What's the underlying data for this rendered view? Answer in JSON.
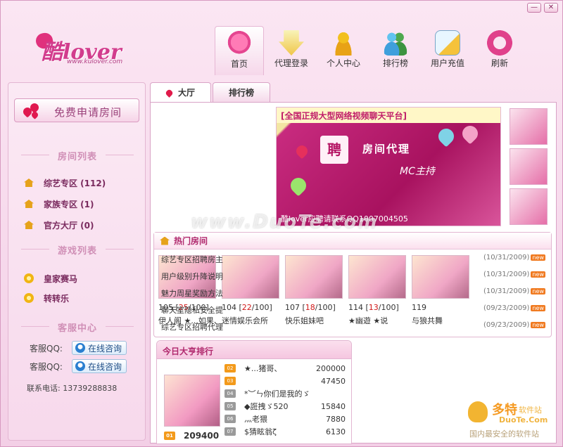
{
  "window": {
    "min_label": "—",
    "close_label": "✕"
  },
  "logo": {
    "text": "酷lover",
    "sub": "www.kulover.com"
  },
  "nav": [
    {
      "label": "首页",
      "icon": "home-heart-icon",
      "active": true
    },
    {
      "label": "代理登录",
      "icon": "download-arrow-icon"
    },
    {
      "label": "个人中心",
      "icon": "user-icon"
    },
    {
      "label": "排行榜",
      "icon": "users-rank-icon"
    },
    {
      "label": "用户充值",
      "icon": "chart-coin-icon"
    },
    {
      "label": "刷新",
      "icon": "refresh-icon"
    }
  ],
  "sidebar": {
    "apply_label": "免费申请房间",
    "room_list_title": "房间列表",
    "rooms": [
      {
        "label": "综艺专区 (112)"
      },
      {
        "label": "家族专区 (1)"
      },
      {
        "label": "官方大厅 (0)"
      }
    ],
    "game_list_title": "游戏列表",
    "games": [
      {
        "label": "皇家赛马"
      },
      {
        "label": "转转乐"
      }
    ],
    "service_title": "客服中心",
    "qq": [
      {
        "label": "客服QQ:",
        "button": "在线咨询"
      },
      {
        "label": "客服QQ:",
        "button": "在线咨询"
      }
    ],
    "phone": "联系电话:   13739288838"
  },
  "tabs": [
    {
      "label": "大厅",
      "active": true
    },
    {
      "label": "排行榜"
    }
  ],
  "banner": {
    "top": "[全国正规大型网络视频聊天平台]",
    "hire": "聘",
    "title": "房间代理",
    "mc": "MC主持",
    "contact": "酷lover应聘请联系QQ1007004505"
  },
  "hot": {
    "title": "热门房间",
    "news": [
      "综艺专区招聘房主",
      "用户级别升降说明",
      "魅力周星奖励方法",
      "聊天室隐私安全提",
      "综艺专区招聘代理"
    ],
    "dates": [
      "(10/31/2009)",
      "(10/31/2009)",
      "(10/31/2009)",
      "(09/23/2009)",
      "(09/23/2009)"
    ],
    "new_label": "new",
    "rooms": [
      {
        "id": "105",
        "cur": "25",
        "max": "/100",
        "name": "伊人阁  ★...如果、爱"
      },
      {
        "id": "104",
        "cur": "22",
        "max": "/100",
        "name": "迷情娱乐会所"
      },
      {
        "id": "107",
        "cur": "18",
        "max": "/100",
        "name": "快乐姐妹吧"
      },
      {
        "id": "114",
        "cur": "13",
        "max": "/100",
        "name": "★幽遊 ★说"
      },
      {
        "id": "119",
        "cur": "",
        "max": "",
        "name": "与狼共舞"
      }
    ]
  },
  "rank": {
    "title": "今日大亨排行",
    "top_badge": "01",
    "top_score": "209400",
    "rows": [
      {
        "badge": "02",
        "name": "★...猪哥、",
        "score": "200000",
        "color": "#f39a1b"
      },
      {
        "badge": "03",
        "name": "",
        "score": "47450",
        "color": "#f39a1b"
      },
      {
        "badge": "04",
        "name": "*︶ㄣ你们是我的ゞ",
        "score": "",
        "color": "#9a9a9a"
      },
      {
        "badge": "05",
        "name": "◆誑拽ゞ520",
        "score": "15840",
        "color": "#9a9a9a"
      },
      {
        "badge": "06",
        "name": "灬老猥",
        "score": "7880",
        "color": "#9a9a9a"
      },
      {
        "badge": "07",
        "name": "$猜眩翁ζ",
        "score": "6130",
        "color": "#9a9a9a"
      }
    ]
  },
  "watermark": {
    "text": "www.DuoTe.com",
    "cn": "多特",
    "cn2": "软件站",
    "en": "DuoTe.Com",
    "slogan": "国内最安全的软件站"
  }
}
